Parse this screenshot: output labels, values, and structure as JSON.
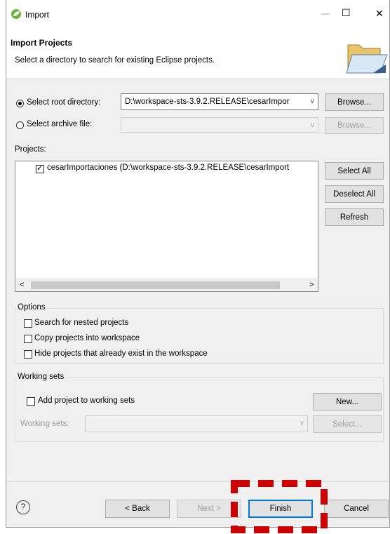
{
  "window": {
    "title": "Import",
    "minimize_glyph": "—",
    "maximize_glyph": "☐",
    "close_glyph": "✕"
  },
  "banner": {
    "heading": "Import Projects",
    "description": "Select a directory to search for existing Eclipse projects."
  },
  "source": {
    "root_label": "Select root directory:",
    "root_value": "D:\\workspace-sts-3.9.2.RELEASE\\cesarImpor",
    "root_selected": true,
    "archive_label": "Select archive file:",
    "archive_value": "",
    "browse_label": "Browse...",
    "browse_archive_label": "Browse..."
  },
  "projects": {
    "label": "Projects:",
    "items": [
      {
        "label": "cesarImportaciones (D:\\workspace-sts-3.9.2.RELEASE\\cesarImport",
        "checked": true
      }
    ],
    "select_all": "Select All",
    "deselect_all": "Deselect All",
    "refresh": "Refresh",
    "scroll_left": "<",
    "scroll_right": ">"
  },
  "options": {
    "legend": "Options",
    "items": [
      {
        "label": "Search for nested projects",
        "checked": false
      },
      {
        "label": "Copy projects into workspace",
        "checked": false
      },
      {
        "label": "Hide projects that already exist in the workspace",
        "checked": false
      }
    ]
  },
  "working_sets": {
    "legend": "Working sets",
    "add_label": "Add project to working sets",
    "new_button": "New...",
    "sets_label": "Working sets:",
    "select_button": "Select..."
  },
  "footer": {
    "help_glyph": "?",
    "back": "< Back",
    "next": "Next >",
    "finish": "Finish",
    "cancel": "Cancel"
  },
  "colors": {
    "highlight": "#cc0000",
    "focus": "#0078d7",
    "scroll_thumb": "#c8c8c8"
  }
}
